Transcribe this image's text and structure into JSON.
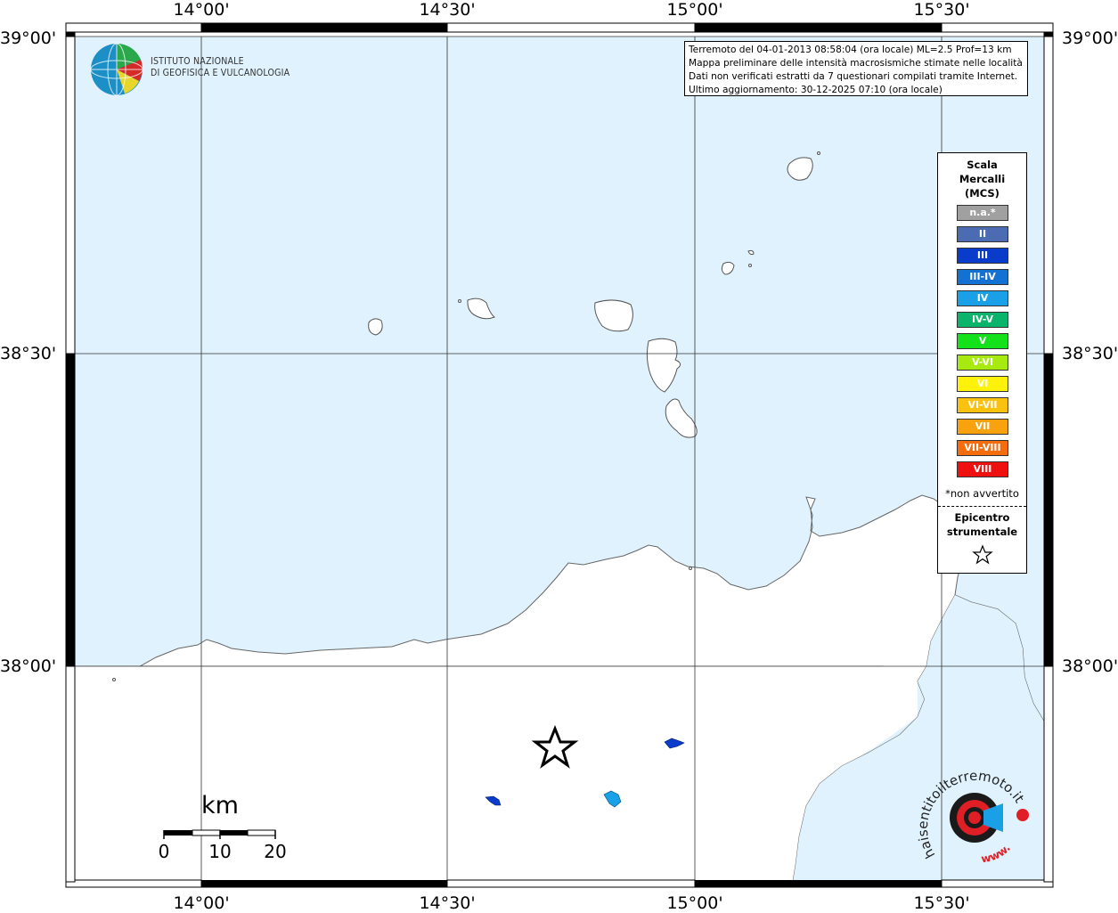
{
  "map": {
    "ticks_top": [
      "14°00'",
      "14°30'",
      "15°00'",
      "15°30'"
    ],
    "ticks_bottom": [
      "14°00'",
      "14°30'",
      "15°00'",
      "15°30'"
    ],
    "ticks_left": [
      "39°00'",
      "38°30'",
      "38°00'"
    ],
    "ticks_right": [
      "39°00'",
      "38°30'",
      "38°00'"
    ],
    "sea_color": "#dff2fd"
  },
  "info": {
    "line1": "Terremoto del 04-01-2013 08:58:04 (ora locale) ML=2.5 Prof=13 km",
    "line2": "Mappa preliminare delle intensità macrosismiche stimate nelle località",
    "line3": "Dati non verificati estratti da 7 questionari compilati tramite Internet.",
    "line4": "Ultimo aggiornamento: 30-12-2025 07:10 (ora locale)"
  },
  "logo": {
    "line1": "ISTITUTO NAZIONALE",
    "line2": "DI GEOFISICA E VULCANOLOGIA"
  },
  "legend": {
    "title_lines": [
      "Scala",
      "Mercalli",
      "(MCS)"
    ],
    "items": [
      {
        "label": "n.a.*",
        "color": "#a0a0a0"
      },
      {
        "label": "II",
        "color": "#4b6bb3"
      },
      {
        "label": "III",
        "color": "#0a3ccb"
      },
      {
        "label": "III-IV",
        "color": "#1371d4"
      },
      {
        "label": "IV",
        "color": "#19a0e6"
      },
      {
        "label": "IV-V",
        "color": "#0ab46a"
      },
      {
        "label": "V",
        "color": "#13e21a"
      },
      {
        "label": "V-VI",
        "color": "#a6ea0f"
      },
      {
        "label": "VI",
        "color": "#fff20a"
      },
      {
        "label": "VI-VII",
        "color": "#f8c20f"
      },
      {
        "label": "VII",
        "color": "#f8a30d"
      },
      {
        "label": "VII-VIII",
        "color": "#f46c0c"
      },
      {
        "label": "VIII",
        "color": "#ef1010"
      }
    ],
    "note": "*non avvertito",
    "epicentre_lines": [
      "Epicentro",
      "strumentale"
    ]
  },
  "scale": {
    "unit": "km",
    "labels": [
      "0",
      "10",
      "20"
    ]
  },
  "hst": {
    "text": "haisentitoilterremoto.it",
    "url_text": "www."
  }
}
